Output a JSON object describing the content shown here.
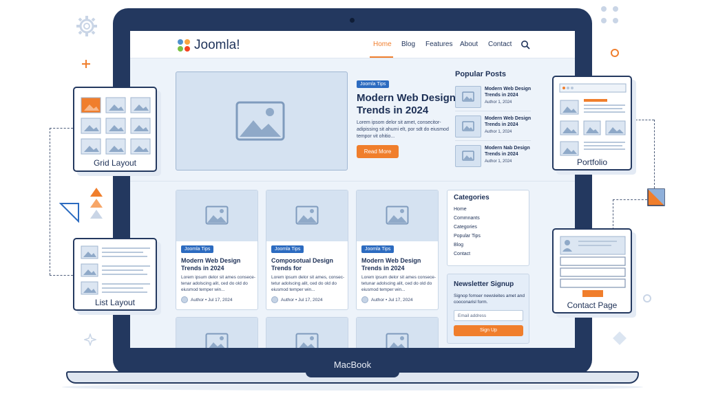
{
  "laptop": {
    "brand_label": "MacBook"
  },
  "site": {
    "logo_text": "Joomla!",
    "nav": [
      "Home",
      "Blog",
      "Features",
      "About",
      "Contact"
    ],
    "active_nav": "Home"
  },
  "hero": {
    "tag": "Joomla Tips",
    "title": "Modern Web Design Trends in 2024",
    "text": "Lorem ipsom delor sit amet, consecitor- adipissing sit ahumi elt, por sdt do eiusmod tempor vit ohitio...",
    "button": "Read More"
  },
  "popular": {
    "heading": "Popular Posts",
    "items": [
      {
        "title": "Modern Web Design Trends in 2024",
        "meta": "Author 1, 2024"
      },
      {
        "title": "Modern Web Design Trends in 2024",
        "meta": "Author 1, 2024"
      },
      {
        "title": "Modern Nab Design Trends in 2024",
        "meta": "Author 1, 2024"
      }
    ]
  },
  "cards": [
    {
      "tag": "Joomla Tips",
      "title": "Modern Web Design Trends in 2024",
      "text": "Lorem ipsum delor sit ames consece- tenar adolscing alit, ced do old do eiusmod temper win...",
      "meta": "Author • Jul 17, 2024"
    },
    {
      "tag": "Joomla Tips",
      "title": "Composotual Design Trends for",
      "text": "Lorem ipsum delor sit ames, consec- tetur adolscing alit, ced do old do eiusmod temper win...",
      "meta": "Author • Jul 17, 2024"
    },
    {
      "tag": "Joomla Tips",
      "title": "Modern Web Design Trends in 2024",
      "text": "Lorem ipsum delor sit ames consece- tetunar adolscing alit, ced do old do eiusmod temper win...",
      "meta": "Author • Jul 17, 2024"
    }
  ],
  "categories": {
    "heading": "Categories",
    "items": [
      "Home",
      "Commnants",
      "Categories",
      "Popular Tips",
      "Blog",
      "Contact"
    ]
  },
  "newsletter": {
    "heading": "Newsletter Signup",
    "text": "Signop fomser newsleites amet and cooconarisl form.",
    "placeholder": "Email address",
    "button": "Sign Up"
  },
  "panels": {
    "grid": "Grid Layout",
    "list": "List Layout",
    "portfolio": "Portfolio",
    "contact": "Contact Page"
  },
  "colors": {
    "accent": "#f07e2c",
    "brand_blue": "#2c6bc0",
    "laptop_frame": "#23385f"
  }
}
